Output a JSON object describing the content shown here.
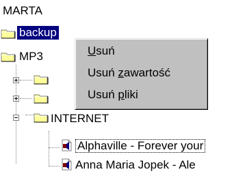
{
  "tree": {
    "root_label": "MARTA",
    "nodes": [
      {
        "label": "backup"
      },
      {
        "label": "MP3"
      },
      {
        "label": "INTERNET"
      }
    ],
    "files": [
      {
        "label": "Alphaville - Forever your"
      },
      {
        "label": "Anna Maria Jopek - Ale"
      }
    ]
  },
  "context_menu": {
    "items": [
      {
        "pre": "",
        "accel": "U",
        "post": "suń"
      },
      {
        "pre": "Usuń ",
        "accel": "z",
        "post": "awartość"
      },
      {
        "pre": "Usuń ",
        "accel": "p",
        "post": "liki"
      }
    ]
  },
  "colors": {
    "selection": "#000080",
    "folder": "#ffff99",
    "menu": "#c0c0c0"
  }
}
